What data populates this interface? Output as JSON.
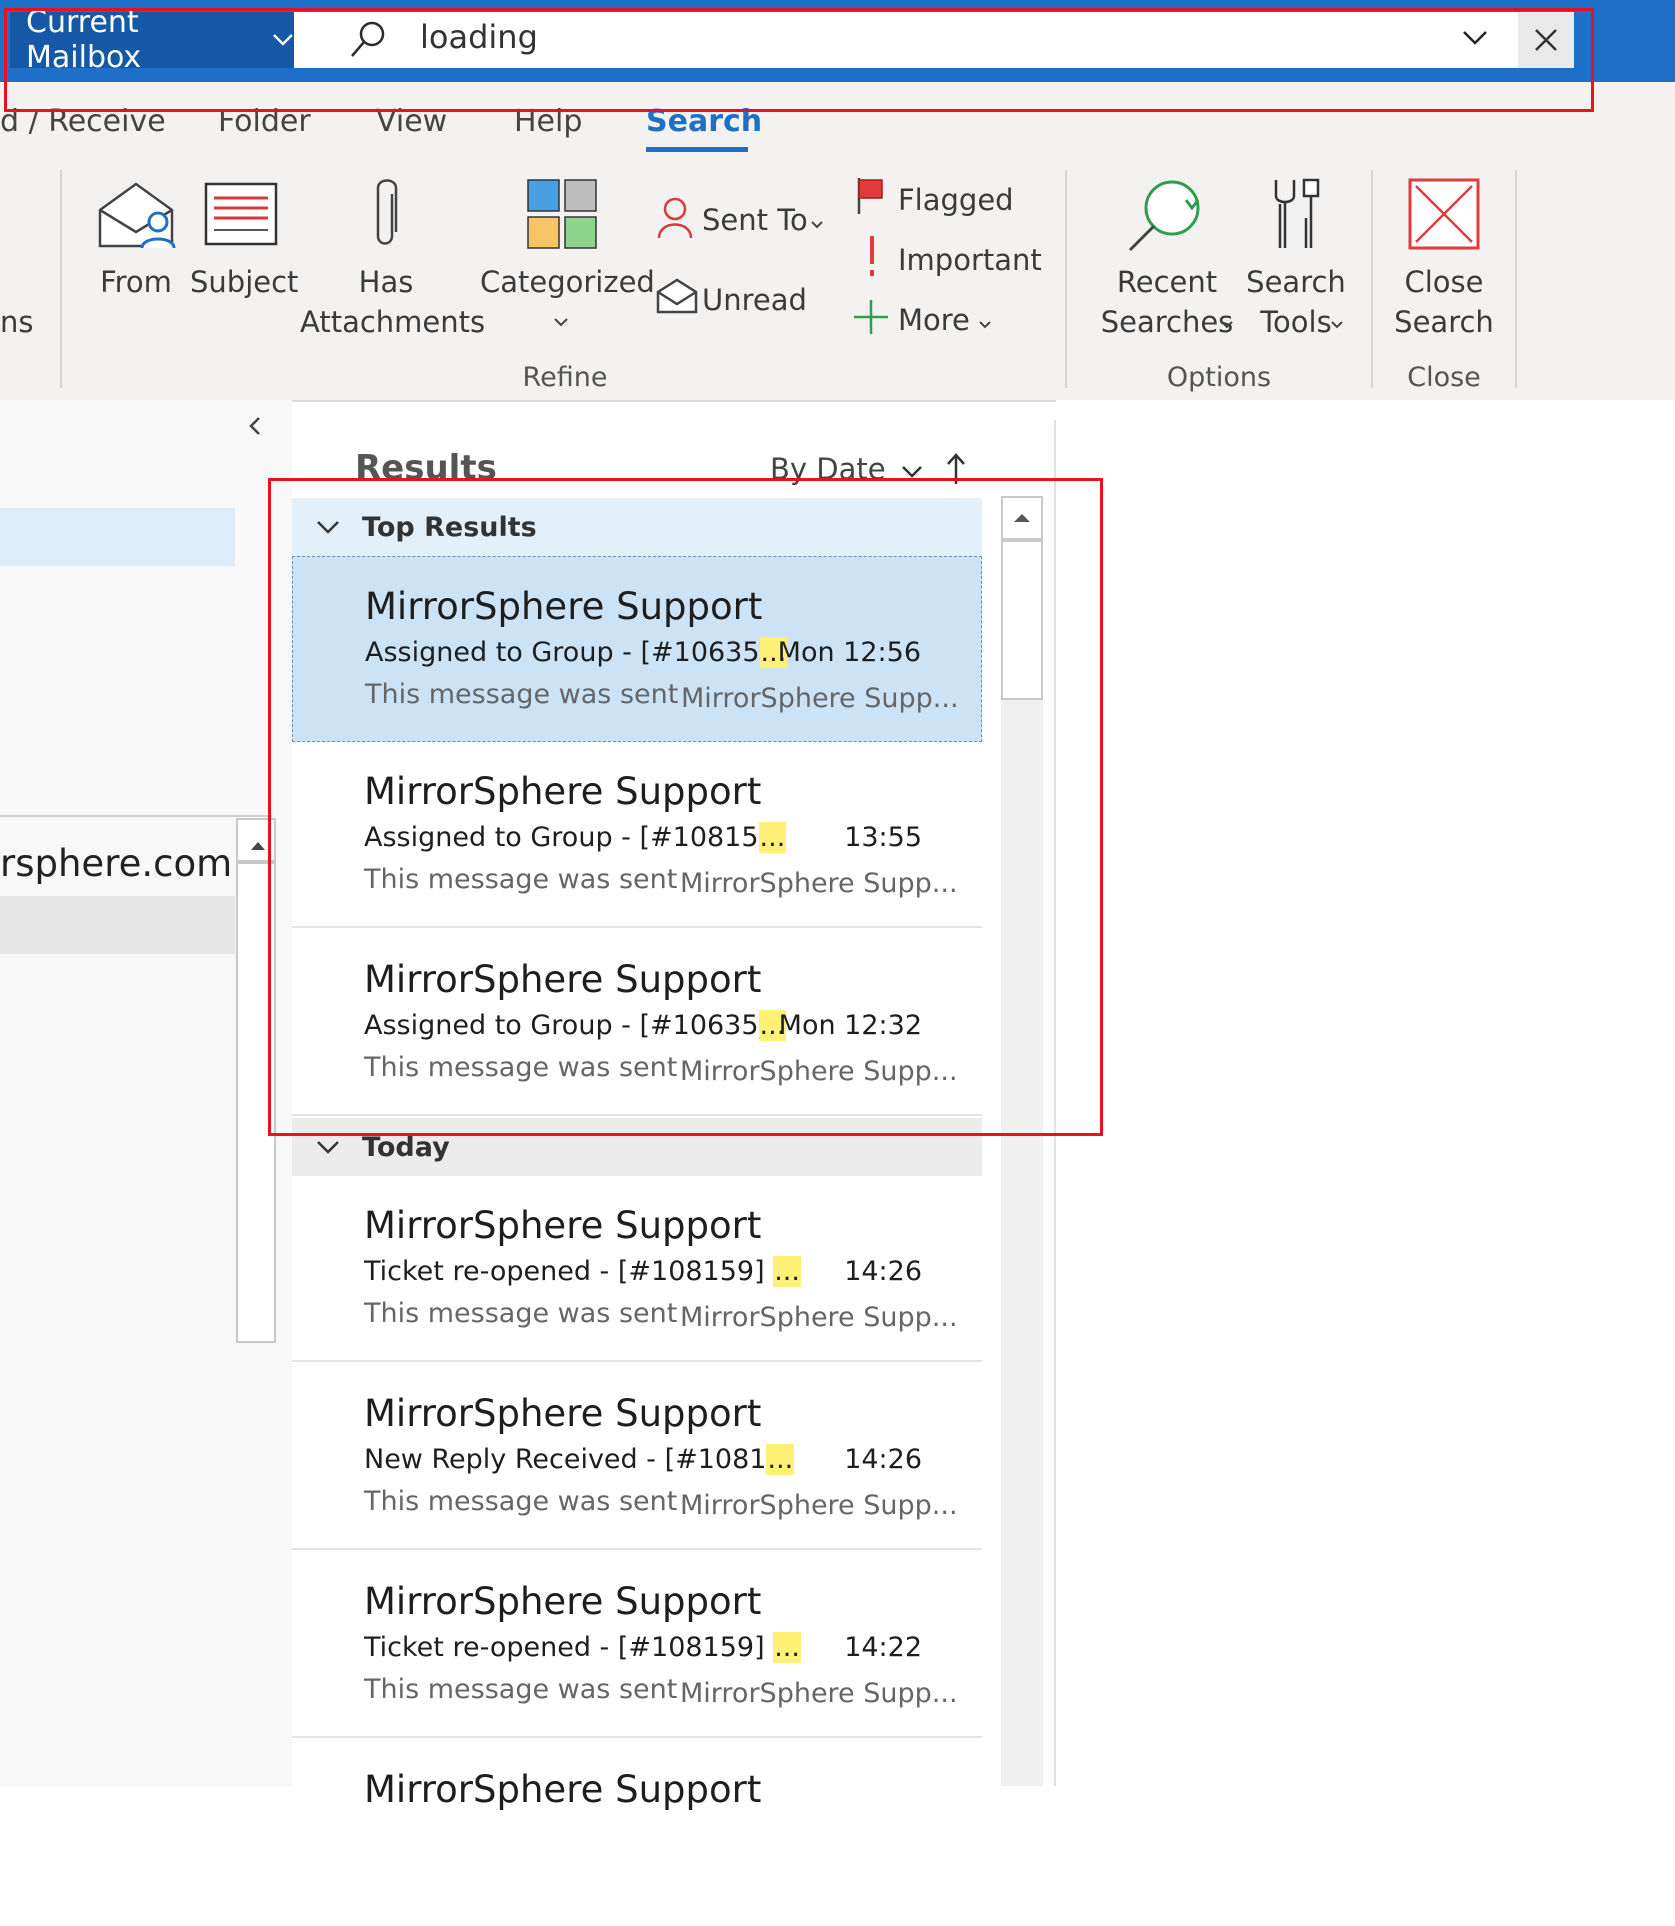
{
  "search": {
    "scope_label": "Current Mailbox",
    "query": "loading"
  },
  "ribbon": {
    "tabs": [
      "d / Receive",
      "Folder",
      "View",
      "Help",
      "Search"
    ],
    "active_tab": "Search",
    "left_edge_label": "ns",
    "buttons": {
      "from": "From",
      "subject": "Subject",
      "has_attachments_1": "Has",
      "has_attachments_2": "Attachments",
      "categorized": "Categorized",
      "sent_to": "Sent To",
      "unread": "Unread",
      "flagged": "Flagged",
      "important": "Important",
      "more": "More",
      "recent_searches_1": "Recent",
      "recent_searches_2": "Searches",
      "search_tools_1": "Search",
      "search_tools_2": "Tools",
      "close_search_1": "Close",
      "close_search_2": "Search"
    },
    "groups": {
      "refine": "Refine",
      "options": "Options",
      "close": "Close"
    }
  },
  "folder_pane": {
    "account_fragment": "rsphere.com"
  },
  "results": {
    "title": "Results",
    "sort_label": "By Date",
    "groups": [
      {
        "name": "Top Results",
        "items": [
          {
            "sender": "MirrorSphere Support",
            "subject": "Assigned to Group - [#10635",
            "time": "Mon 12:56",
            "preview": "This message was sent",
            "from": "MirrorSphere Supp..."
          },
          {
            "sender": "MirrorSphere Support",
            "subject": "Assigned to Group - [#10815",
            "time": "13:55",
            "preview": "This message was sent",
            "from": "MirrorSphere Supp..."
          },
          {
            "sender": "MirrorSphere Support",
            "subject": "Assigned to Group - [#10635",
            "time": "Mon 12:32",
            "preview": "This message was sent",
            "from": "MirrorSphere Supp..."
          }
        ]
      },
      {
        "name": "Today",
        "items": [
          {
            "sender": "MirrorSphere Support",
            "subject": "Ticket re-opened - [#108159] ",
            "time": "14:26",
            "preview": "This message was sent",
            "from": "MirrorSphere Supp..."
          },
          {
            "sender": "MirrorSphere Support",
            "subject": "New Reply Received - [#1081",
            "time": "14:26",
            "preview": "This message was sent",
            "from": "MirrorSphere Supp..."
          },
          {
            "sender": "MirrorSphere Support",
            "subject": "Ticket re-opened - [#108159] ",
            "time": "14:22",
            "preview": "This message was sent",
            "from": "MirrorSphere Supp..."
          },
          {
            "sender": "MirrorSphere Support"
          }
        ]
      }
    ],
    "highlight_text": "..."
  },
  "colors": {
    "accent": "#1d6fc7",
    "selected_item": "#cce3f5",
    "annotation_red": "#e81123",
    "highlight": "#fff176"
  }
}
